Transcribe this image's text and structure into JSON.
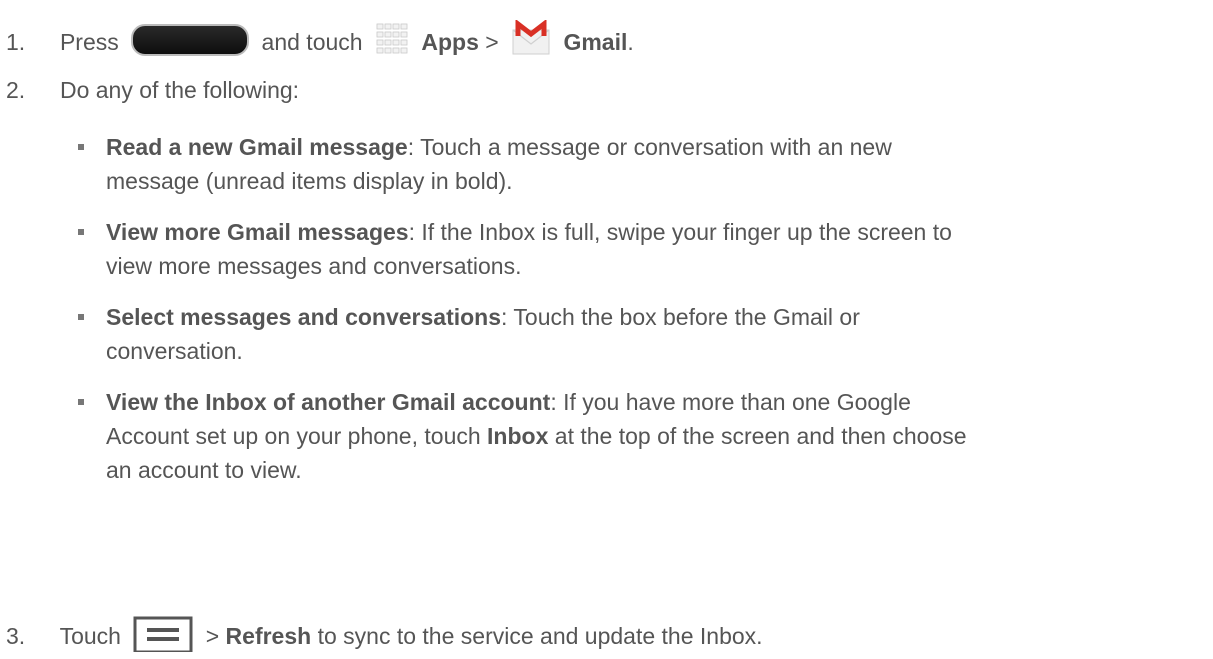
{
  "steps": {
    "step1": {
      "num": "1.",
      "press": "Press",
      "and_touch": "and touch",
      "apps": "Apps",
      "sep": ">",
      "gmail": "Gmail",
      "period": "."
    },
    "step2": {
      "num": "2.",
      "text": "Do any of the following:"
    },
    "bullets": [
      {
        "title": "Read a new Gmail message",
        "line1": ": Touch a message or conversation with an new",
        "line2": "message (unread items display in bold)."
      },
      {
        "title": "View more Gmail messages",
        "line1": ": If the Inbox is full, swipe your finger up the screen to",
        "line2": "view more messages and conversations."
      },
      {
        "title": "Select messages and conversations",
        "line1": ": Touch the box before the Gmail or",
        "line2": "conversation."
      },
      {
        "title": "View the Inbox of another Gmail account",
        "line1": ": If you have more than one Google",
        "line2a": "Account set up on your phone, touch ",
        "line2b": "Inbox",
        "line2c": " at the top of the screen and then choose",
        "line3": "an account to view."
      }
    ],
    "step3": {
      "num": "3.",
      "touch": "Touch",
      "sep": ">",
      "refresh": "Refresh",
      "rest": " to sync to the service and update the Inbox."
    }
  },
  "icons": {
    "home_key": "home-key-icon",
    "apps": "apps-grid-icon",
    "gmail": "gmail-envelope-icon",
    "menu": "menu-key-icon"
  }
}
